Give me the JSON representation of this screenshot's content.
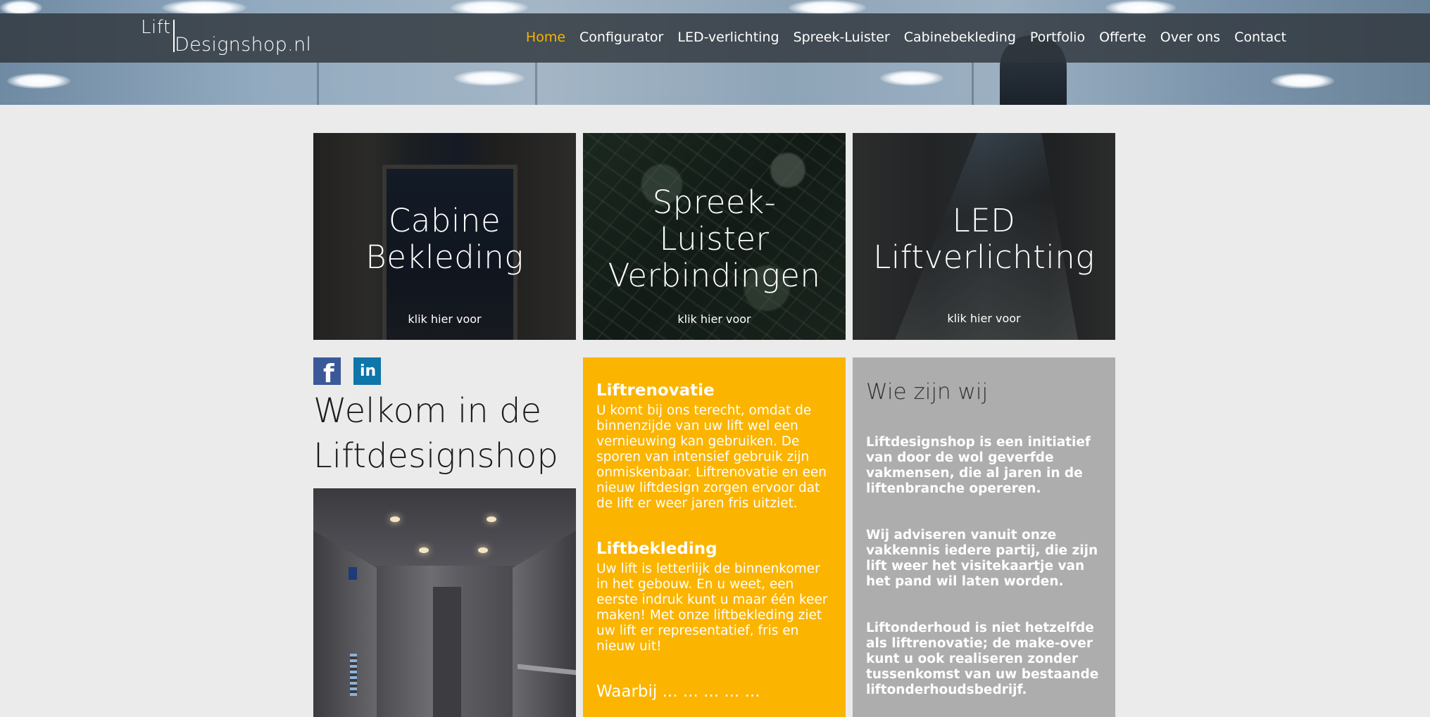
{
  "brand": {
    "logo_line1": "Lift",
    "logo_line2": "Designshop.nl"
  },
  "nav": {
    "items": [
      {
        "label": "Home",
        "active": true
      },
      {
        "label": "Configurator"
      },
      {
        "label": "LED-verlichting"
      },
      {
        "label": "Spreek-Luister"
      },
      {
        "label": "Cabinebekleding"
      },
      {
        "label": "Portfolio"
      },
      {
        "label": "Offerte"
      },
      {
        "label": "Over ons"
      },
      {
        "label": "Contact"
      }
    ],
    "active_color": "#f5b400"
  },
  "tiles": [
    {
      "lines": [
        "Cabine",
        "Bekleding"
      ],
      "cta": "klik hier voor"
    },
    {
      "lines": [
        "Spreek-",
        "Luister",
        "Verbindingen"
      ],
      "cta": "klik hier voor"
    },
    {
      "lines": [
        "LED",
        "Liftverlichting"
      ],
      "cta": "klik hier voor"
    }
  ],
  "social": {
    "facebook_icon": "facebook-icon",
    "linkedin_icon": "linkedin-icon"
  },
  "welcome": {
    "line1": "Welkom in de",
    "line2": "Liftdesignshop"
  },
  "yellow_box": {
    "color": "#fbb400",
    "sections": [
      {
        "title": "Liftrenovatie",
        "text": "U komt bij ons terecht, omdat de binnenzijde van uw lift wel een vernieuwing kan gebruiken. De sporen van intensief gebruik zijn onmiskenbaar. Liftrenovatie en een nieuw liftdesign zorgen ervoor dat de lift er weer jaren fris uitziet."
      },
      {
        "title": "Liftbekleding",
        "text": "Uw lift is letterlijk de binnenkomer in het gebouw. En u weet, een eerste indruk kunt u maar één keer maken! Met onze liftbekleding ziet uw lift er representatief, fris en nieuw uit!"
      },
      {
        "title": "Waarbij ... ... ... ... ... ",
        "text": ""
      }
    ]
  },
  "grey_box": {
    "title": "Wie zijn wij",
    "paragraphs": [
      "Liftdesignshop is een initiatief van door de wol geverfde vakmensen, die al jaren in de liftenbranche opereren.",
      "Wij adviseren vanuit onze vakkennis iedere partij, die zijn lift weer het visitekaartje van het pand wil laten worden.",
      "Liftonderhoud is niet hetzelfde als liftrenovatie; de make-over kunt u ook realiseren zonder tussenkomst van uw bestaande liftonderhoudsbedrijf."
    ]
  }
}
